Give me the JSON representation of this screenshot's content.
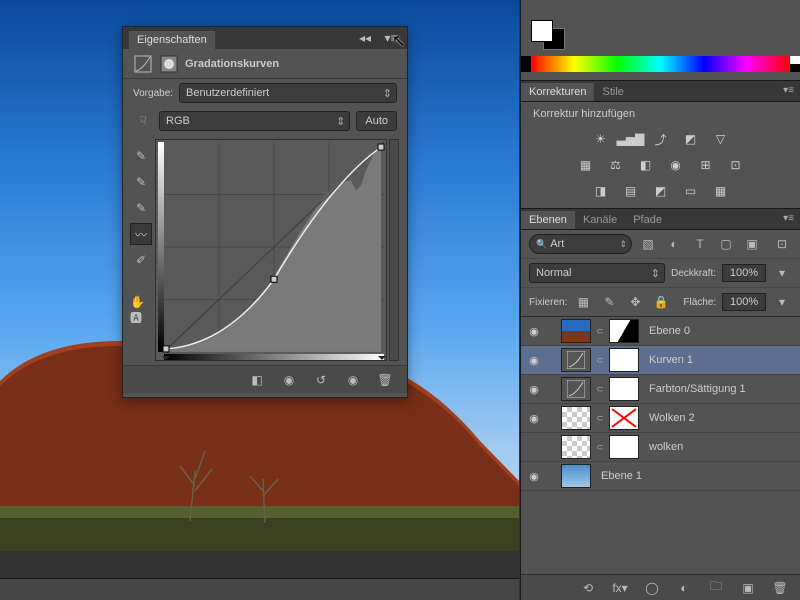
{
  "properties_panel": {
    "tab": "Eigenschaften",
    "title": "Gradationskurven",
    "preset_label": "Vorgabe:",
    "preset_value": "Benutzerdefiniert",
    "channel": "RGB",
    "auto": "Auto"
  },
  "corrections_panel": {
    "tabs": [
      "Korrekturen",
      "Stile"
    ],
    "title": "Korrektur hinzufügen"
  },
  "layers_panel": {
    "tabs": [
      "Ebenen",
      "Kanäle",
      "Pfade"
    ],
    "search": "Art",
    "blend_mode": "Normal",
    "opacity_label": "Deckkraft:",
    "opacity_value": "100%",
    "lock_label": "Fixieren:",
    "fill_label": "Fläche:",
    "fill_value": "100%",
    "layers": [
      {
        "name": "Ebene 0",
        "visible": true,
        "thumb": "image",
        "mask": "partial"
      },
      {
        "name": "Kurven 1",
        "visible": true,
        "thumb": "adj",
        "mask": "white",
        "selected": true
      },
      {
        "name": "Farbton/Sättigung 1",
        "visible": true,
        "thumb": "adj",
        "mask": "white"
      },
      {
        "name": "Wolken 2",
        "visible": true,
        "thumb": "trans",
        "mask": "x"
      },
      {
        "name": "wolken",
        "visible": false,
        "thumb": "trans",
        "mask": "white"
      },
      {
        "name": "Ebene 1",
        "visible": true,
        "thumb": "sky"
      }
    ]
  }
}
